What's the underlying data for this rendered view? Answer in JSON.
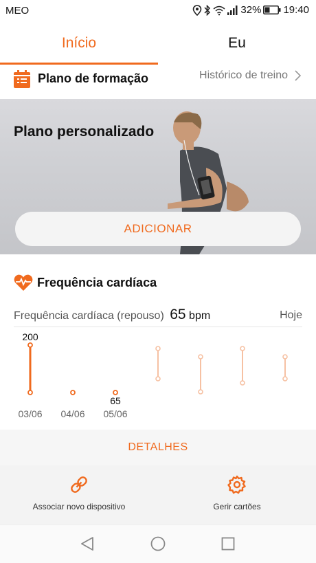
{
  "status_bar": {
    "carrier": "MEO",
    "battery": "32%",
    "time": "19:40"
  },
  "tabs": [
    {
      "label": "Início",
      "active": true
    },
    {
      "label": "Eu",
      "active": false
    }
  ],
  "training_plan": {
    "title": "Plano de formação",
    "history_link": "Histórico de treino"
  },
  "hero": {
    "title": "Plano personalizado",
    "button": "ADICIONAR"
  },
  "heart_rate": {
    "title": "Frequência cardíaca",
    "resting_label": "Frequência cardíaca (repouso)",
    "resting_value": "65",
    "unit": "bpm",
    "period": "Hoje"
  },
  "chart_data": {
    "type": "range-bar",
    "categories": [
      "03/06",
      "04/06",
      "05/06"
    ],
    "labels": [
      "200",
      "",
      "65"
    ],
    "ranges": [
      [
        65,
        200
      ],
      [
        65,
        65
      ],
      [
        65,
        65
      ]
    ],
    "future_placeholders": 4
  },
  "details_button": "DETALHES",
  "actions": [
    {
      "icon": "link-icon",
      "label": "Associar novo dispositivo"
    },
    {
      "icon": "gear-icon",
      "label": "Gerir cartões"
    }
  ],
  "colors": {
    "accent": "#f06a1e",
    "muted_accent": "#f6c1a3"
  }
}
